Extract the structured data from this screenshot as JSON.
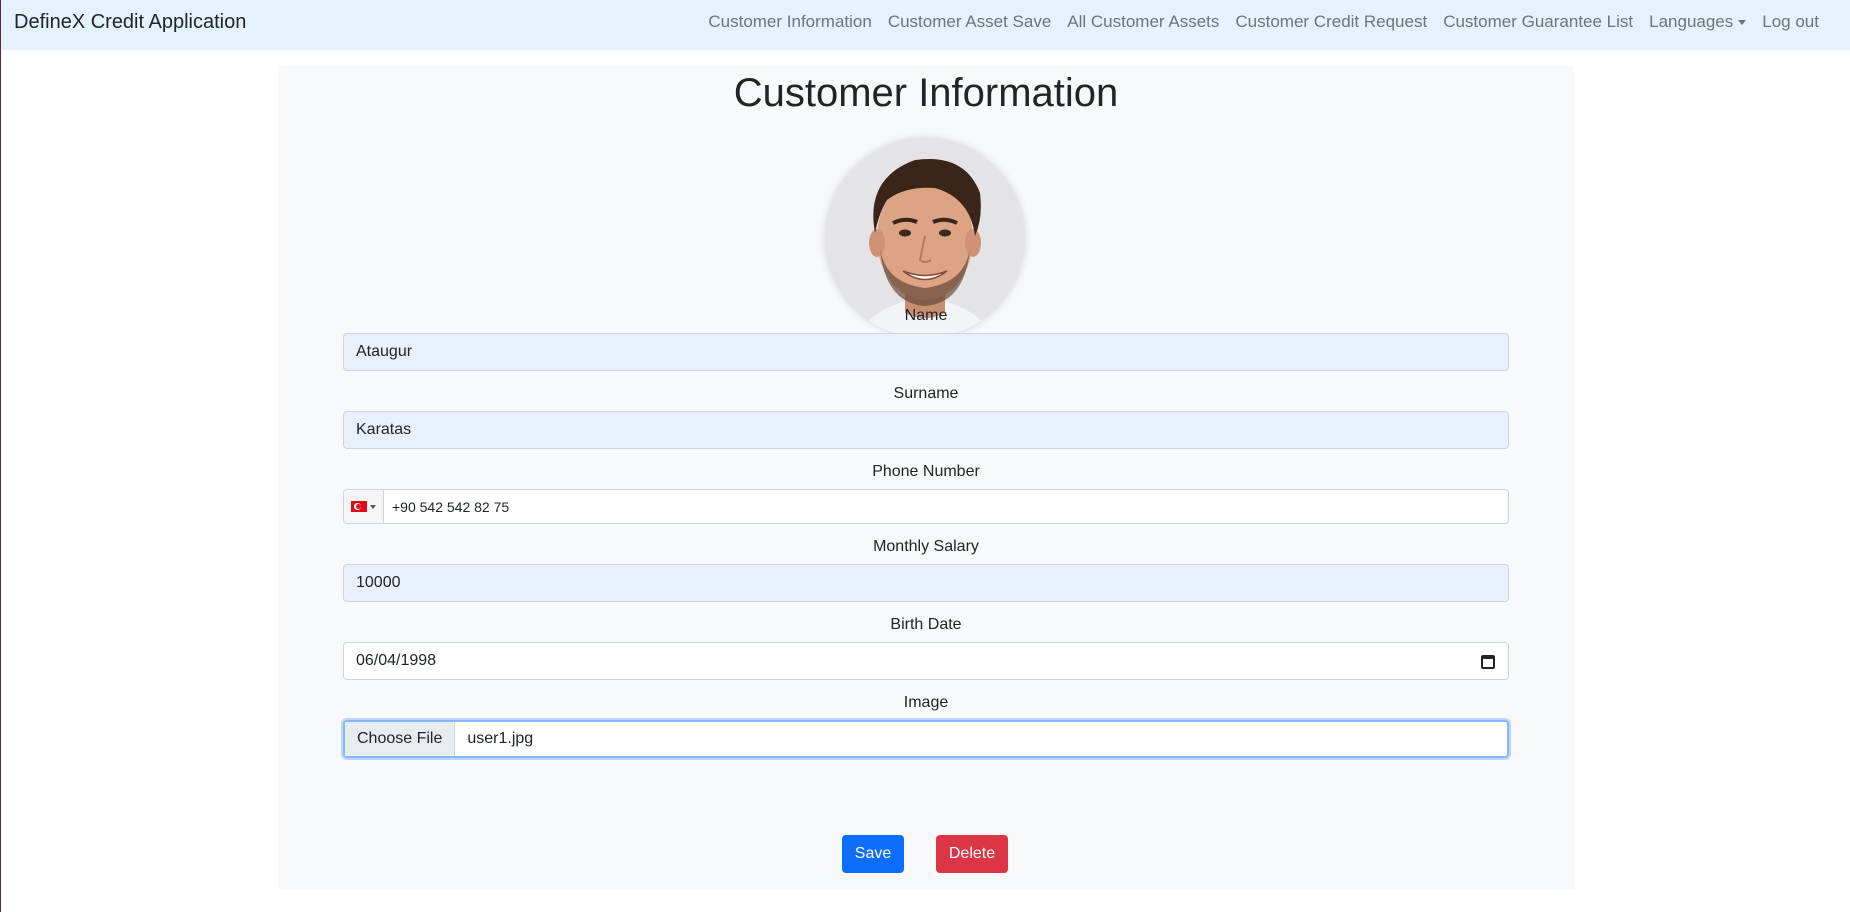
{
  "navbar": {
    "brand": "DefineX Credit Application",
    "links": [
      "Customer Information",
      "Customer Asset Save",
      "All Customer Assets",
      "Customer Credit Request",
      "Customer Guarantee List",
      "Languages",
      "Log out"
    ]
  },
  "page": {
    "title": "Customer Information"
  },
  "form": {
    "name_label": "Name",
    "name_value": "Ataugur",
    "surname_label": "Surname",
    "surname_value": "Karatas",
    "phone_label": "Phone Number",
    "phone_value": "+90 542 542 82 75",
    "phone_country_icon": "turkey-flag-icon",
    "salary_label": "Monthly Salary",
    "salary_value": "10000",
    "birth_label": "Birth Date",
    "birth_value": "06/04/1998",
    "image_label": "Image",
    "file_button": "Choose File",
    "file_name": "user1.jpg"
  },
  "buttons": {
    "save": "Save",
    "delete": "Delete"
  },
  "colors": {
    "navbar_bg": "#e3f2fd",
    "save": "#0d6efd",
    "delete": "#dc3545",
    "card_bg": "#f8f9fa"
  }
}
